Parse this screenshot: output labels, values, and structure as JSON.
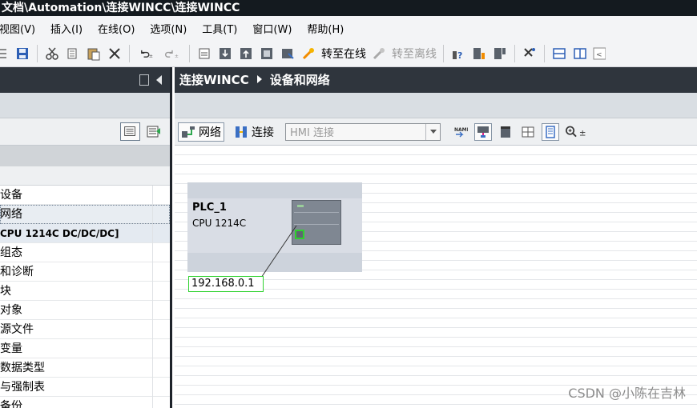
{
  "window": {
    "title": "文档\\Automation\\连接WINCC\\连接WINCC"
  },
  "menu": {
    "items": [
      {
        "label": "视图(V)"
      },
      {
        "label": "插入(I)"
      },
      {
        "label": "在线(O)"
      },
      {
        "label": "选项(N)"
      },
      {
        "label": "工具(T)"
      },
      {
        "label": "窗口(W)"
      },
      {
        "label": "帮助(H)"
      }
    ]
  },
  "toolbar": {
    "go_online_label": "转至在线",
    "go_offline_label": "转至离线",
    "icons": [
      "save-icon",
      "cut-icon",
      "copy-icon",
      "paste-icon",
      "delete-icon",
      "undo-icon",
      "redo-icon",
      "compile-icon",
      "download-icon",
      "upload-icon",
      "simulate-icon",
      "go-online-icon",
      "go-offline-icon",
      "accessible-devices-icon",
      "split-horizontal-icon",
      "split-vertical-icon"
    ]
  },
  "project_tree": {
    "items": [
      {
        "label": "设备"
      },
      {
        "label": "网络"
      },
      {
        "label": "CPU 1214C DC/DC/DC]"
      },
      {
        "label": "组态"
      },
      {
        "label": "和诊断"
      },
      {
        "label": "块"
      },
      {
        "label": "对象"
      },
      {
        "label": "源文件"
      },
      {
        "label": "变量"
      },
      {
        "label": "数据类型"
      },
      {
        "label": "与强制表"
      },
      {
        "label": "备份"
      }
    ]
  },
  "breadcrumb": {
    "parent": "连接WINCC",
    "current": "设备和网络"
  },
  "network_toolbar": {
    "network_label": "网络",
    "connections_label": "连接",
    "connection_type": "HMI 连接"
  },
  "device": {
    "name": "PLC_1",
    "type": "CPU 1214C",
    "ip_address": "192.168.0.1"
  },
  "watermark": "CSDN @小陈在吉林",
  "colors": {
    "titlebar": "#141a1f",
    "header_dark": "#2f353d",
    "port_green": "#2fd12f",
    "device_box": "#cdd3dc"
  }
}
